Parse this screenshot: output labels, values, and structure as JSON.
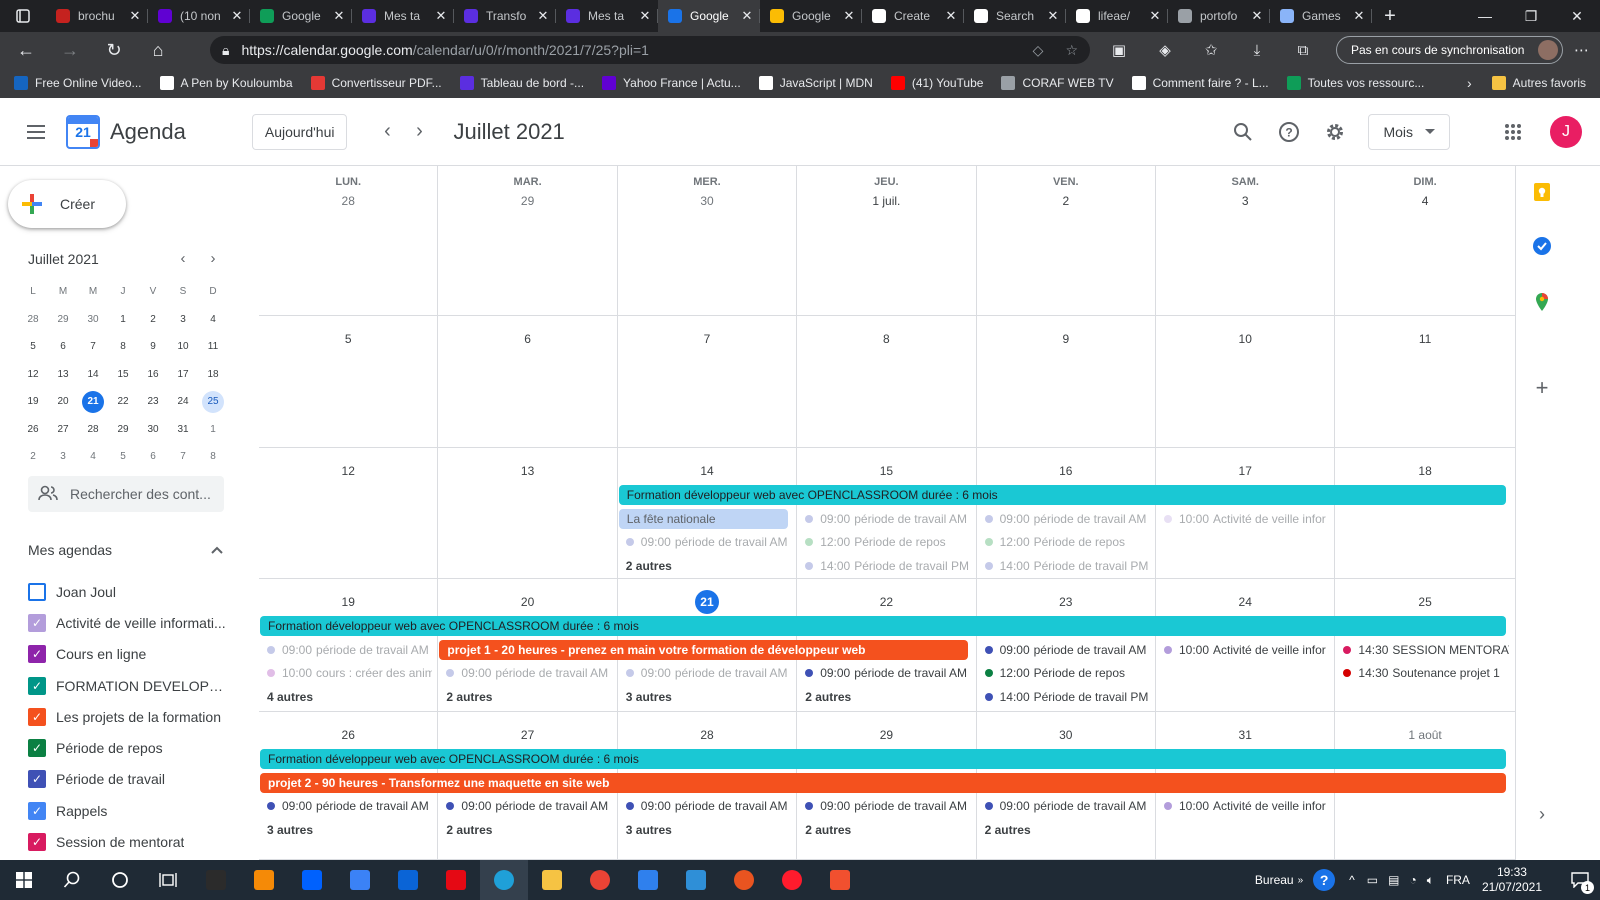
{
  "browser": {
    "tabs": [
      {
        "title": "brochu",
        "color": "#c5221f"
      },
      {
        "title": "(10 non",
        "color": "#6001d2"
      },
      {
        "title": "Google",
        "color": "#0f9d58"
      },
      {
        "title": "Mes ta",
        "color": "#5b2ee0"
      },
      {
        "title": "Transfo",
        "color": "#5b2ee0"
      },
      {
        "title": "Mes ta",
        "color": "#5b2ee0"
      },
      {
        "title": "Google",
        "color": "#1a73e8",
        "active": true
      },
      {
        "title": "Google",
        "color": "#fbbc04"
      },
      {
        "title": "Create",
        "color": "#ffffff"
      },
      {
        "title": "Search",
        "color": "#ffffff"
      },
      {
        "title": "lifeae/",
        "color": "#ffffff"
      },
      {
        "title": "portofo",
        "color": "#9aa0a6"
      },
      {
        "title": "Games",
        "color": "#8ab4f8"
      }
    ],
    "url": {
      "host": "https://calendar.google.com",
      "path": "/calendar/u/0/r/month/2021/7/25?pli=1"
    },
    "sync_label": "Pas en cours de synchronisation",
    "bookmarks": [
      {
        "label": "Free Online Video...",
        "color": "#1565c0"
      },
      {
        "label": "A Pen by Kouloumba",
        "color": "#ffffff"
      },
      {
        "label": "Convertisseur PDF...",
        "color": "#e53935"
      },
      {
        "label": "Tableau de bord -...",
        "color": "#5b2ee0"
      },
      {
        "label": "Yahoo France | Actu...",
        "color": "#6001d2"
      },
      {
        "label": "JavaScript | MDN",
        "color": "#ffffff"
      },
      {
        "label": "(41) YouTube",
        "color": "#ff0000"
      },
      {
        "label": "CORAF WEB TV",
        "color": "#9aa0a6"
      },
      {
        "label": "Comment faire ? - L...",
        "color": "#ffffff"
      },
      {
        "label": "Toutes vos ressourc...",
        "color": "#0f9d58"
      }
    ],
    "other_bookmarks": "Autres favoris"
  },
  "header": {
    "app_title": "Agenda",
    "logo_number": "21",
    "today_button": "Aujourd'hui",
    "month_title": "Juillet 2021",
    "view_selector": "Mois",
    "avatar_letter": "J"
  },
  "sidebar": {
    "create_label": "Créer",
    "mini_title": "Juillet 2021",
    "weekdays": [
      "L",
      "M",
      "M",
      "J",
      "V",
      "S",
      "D"
    ],
    "mini_days": [
      "28",
      "29",
      "30",
      "1",
      "2",
      "3",
      "4",
      "5",
      "6",
      "7",
      "8",
      "9",
      "10",
      "11",
      "12",
      "13",
      "14",
      "15",
      "16",
      "17",
      "18",
      "19",
      "20",
      "21",
      "22",
      "23",
      "24",
      "25",
      "26",
      "27",
      "28",
      "29",
      "30",
      "31",
      "1",
      "2",
      "3",
      "4",
      "5",
      "6",
      "7",
      "8"
    ],
    "search_placeholder": "Rechercher des cont...",
    "my_calendars_title": "Mes agendas",
    "calendars": [
      {
        "label": "Joan Joul",
        "color": "#1a73e8",
        "checked": false
      },
      {
        "label": "Activité de veille informati...",
        "color": "#b39ddb",
        "checked": true
      },
      {
        "label": "Cours en ligne",
        "color": "#8e24aa",
        "checked": true
      },
      {
        "label": "FORMATION DEVELOPPE...",
        "color": "#009688",
        "checked": true
      },
      {
        "label": "Les projets de la formation",
        "color": "#f4511e",
        "checked": true
      },
      {
        "label": "Période de repos",
        "color": "#0b8043",
        "checked": true
      },
      {
        "label": "Période de travail",
        "color": "#3f51b5",
        "checked": true
      },
      {
        "label": "Rappels",
        "color": "#4285f4",
        "checked": true
      },
      {
        "label": "Session de mentorat",
        "color": "#d81b60",
        "checked": true
      }
    ]
  },
  "month": {
    "weekday_headers": [
      "LUN.",
      "MAR.",
      "MER.",
      "JEU.",
      "VEN.",
      "SAM.",
      "DIM."
    ],
    "weeks": [
      [
        "28",
        "29",
        "30",
        "1 juil.",
        "2",
        "3",
        "4"
      ],
      [
        "5",
        "6",
        "7",
        "8",
        "9",
        "10",
        "11"
      ],
      [
        "12",
        "13",
        "14",
        "15",
        "16",
        "17",
        "18"
      ],
      [
        "19",
        "20",
        "21",
        "22",
        "23",
        "24",
        "25"
      ],
      [
        "26",
        "27",
        "28",
        "29",
        "30",
        "31",
        "1 août"
      ]
    ],
    "today_label": "21",
    "spans": [
      {
        "week": 2,
        "start": 2,
        "end": 6,
        "row": 0,
        "label": "Formation développeur web avec OPENCLASSROOM durée : 6 mois",
        "color": "#1ac8d4",
        "style": "dark"
      },
      {
        "week": 2,
        "start": 2,
        "end": 2,
        "row": 1,
        "label": "La fête nationale",
        "color": "#bfd5f5",
        "style": "pale"
      },
      {
        "week": 3,
        "start": 0,
        "end": 6,
        "row": 0,
        "label": "Formation développeur web avec OPENCLASSROOM durée : 6 mois",
        "color": "#1ac8d4",
        "style": "dark"
      },
      {
        "week": 3,
        "start": 1,
        "end": 3,
        "row": 1,
        "label": "projet 1 - 20 heures - prenez en main votre formation de développeur web",
        "color": "#f4511e",
        "style": "white"
      },
      {
        "week": 4,
        "start": 0,
        "end": 6,
        "row": 0,
        "label": "Formation développeur web avec OPENCLASSROOM durée : 6 mois",
        "color": "#1ac8d4",
        "style": "dark"
      },
      {
        "week": 4,
        "start": 0,
        "end": 6,
        "row": 1,
        "label": "projet 2 - 90 heures - Transformez une maquette en site web",
        "color": "#f4511e",
        "style": "white"
      }
    ],
    "events": [
      {
        "week": 2,
        "day": 2,
        "row": 2,
        "time": "09:00",
        "title": "période de travail AM",
        "color": "#c5cae9",
        "faded": true
      },
      {
        "week": 2,
        "day": 3,
        "row": 1,
        "time": "09:00",
        "title": "période de travail AM",
        "color": "#c5cae9",
        "faded": true
      },
      {
        "week": 2,
        "day": 3,
        "row": 2,
        "time": "12:00",
        "title": "Période de repos",
        "color": "#b7dfc3",
        "faded": true
      },
      {
        "week": 2,
        "day": 3,
        "row": 3,
        "time": "14:00",
        "title": "Période de travail PM",
        "color": "#c5cae9",
        "faded": true
      },
      {
        "week": 2,
        "day": 4,
        "row": 1,
        "time": "09:00",
        "title": "période de travail AM",
        "color": "#c5cae9",
        "faded": true
      },
      {
        "week": 2,
        "day": 4,
        "row": 2,
        "time": "12:00",
        "title": "Période de repos",
        "color": "#b7dfc3",
        "faded": true
      },
      {
        "week": 2,
        "day": 4,
        "row": 3,
        "time": "14:00",
        "title": "Période de travail PM",
        "color": "#c5cae9",
        "faded": true
      },
      {
        "week": 2,
        "day": 5,
        "row": 1,
        "time": "10:00",
        "title": "Activité de veille infor",
        "color": "#e8e0f4",
        "faded": true
      },
      {
        "week": 3,
        "day": 0,
        "row": 1,
        "time": "09:00",
        "title": "période de travail AM",
        "color": "#c5cae9",
        "faded": true
      },
      {
        "week": 3,
        "day": 0,
        "row": 2,
        "time": "10:00",
        "title": "cours : créer des anim",
        "color": "#e1bee7",
        "faded": true
      },
      {
        "week": 3,
        "day": 1,
        "row": 2,
        "time": "09:00",
        "title": "période de travail AM",
        "color": "#c5cae9",
        "faded": true
      },
      {
        "week": 3,
        "day": 2,
        "row": 2,
        "time": "09:00",
        "title": "période de travail AM",
        "color": "#c5cae9",
        "faded": true
      },
      {
        "week": 3,
        "day": 3,
        "row": 2,
        "time": "09:00",
        "title": "période de travail AM",
        "color": "#3f51b5",
        "faded": false
      },
      {
        "week": 3,
        "day": 4,
        "row": 1,
        "time": "09:00",
        "title": "période de travail AM",
        "color": "#3f51b5",
        "faded": false
      },
      {
        "week": 3,
        "day": 4,
        "row": 2,
        "time": "12:00",
        "title": "Période de repos",
        "color": "#0b8043",
        "faded": false
      },
      {
        "week": 3,
        "day": 4,
        "row": 3,
        "time": "14:00",
        "title": "Période de travail PM",
        "color": "#3f51b5",
        "faded": false
      },
      {
        "week": 3,
        "day": 5,
        "row": 1,
        "time": "10:00",
        "title": "Activité de veille infor",
        "color": "#b39ddb",
        "faded": false
      },
      {
        "week": 3,
        "day": 6,
        "row": 1,
        "time": "14:30",
        "title": "SESSION MENTORAT",
        "color": "#d81b60",
        "faded": false
      },
      {
        "week": 3,
        "day": 6,
        "row": 2,
        "time": "14:30",
        "title": "Soutenance projet 1",
        "color": "#d50000",
        "faded": false
      },
      {
        "week": 4,
        "day": 0,
        "row": 2,
        "time": "09:00",
        "title": "période de travail AM",
        "color": "#3f51b5",
        "faded": false
      },
      {
        "week": 4,
        "day": 1,
        "row": 2,
        "time": "09:00",
        "title": "période de travail AM",
        "color": "#3f51b5",
        "faded": false
      },
      {
        "week": 4,
        "day": 2,
        "row": 2,
        "time": "09:00",
        "title": "période de travail AM",
        "color": "#3f51b5",
        "faded": false
      },
      {
        "week": 4,
        "day": 3,
        "row": 2,
        "time": "09:00",
        "title": "période de travail AM",
        "color": "#3f51b5",
        "faded": false
      },
      {
        "week": 4,
        "day": 4,
        "row": 2,
        "time": "09:00",
        "title": "période de travail AM",
        "color": "#3f51b5",
        "faded": false
      },
      {
        "week": 4,
        "day": 5,
        "row": 2,
        "time": "10:00",
        "title": "Activité de veille infor",
        "color": "#b39ddb",
        "faded": false
      }
    ],
    "more": [
      {
        "week": 2,
        "day": 2,
        "row": 3,
        "label": "2 autres"
      },
      {
        "week": 3,
        "day": 0,
        "row": 3,
        "label": "4 autres"
      },
      {
        "week": 3,
        "day": 1,
        "row": 3,
        "label": "2 autres"
      },
      {
        "week": 3,
        "day": 2,
        "row": 3,
        "label": "3 autres"
      },
      {
        "week": 3,
        "day": 3,
        "row": 3,
        "label": "2 autres"
      },
      {
        "week": 4,
        "day": 0,
        "row": 3,
        "label": "3 autres"
      },
      {
        "week": 4,
        "day": 1,
        "row": 3,
        "label": "2 autres"
      },
      {
        "week": 4,
        "day": 2,
        "row": 3,
        "label": "3 autres"
      },
      {
        "week": 4,
        "day": 3,
        "row": 3,
        "label": "2 autres"
      },
      {
        "week": 4,
        "day": 4,
        "row": 3,
        "label": "2 autres"
      }
    ]
  },
  "taskbar": {
    "apps": [
      {
        "name": "terminal",
        "color": "#2b2b2b"
      },
      {
        "name": "sublime-text",
        "color": "#f58a07"
      },
      {
        "name": "dropbox",
        "color": "#0061fe"
      },
      {
        "name": "store",
        "color": "#3b82f6"
      },
      {
        "name": "mail",
        "color": "#0a64d6"
      },
      {
        "name": "netflix",
        "color": "#e50914"
      },
      {
        "name": "edge",
        "color": "#1fa0d8"
      },
      {
        "name": "explorer",
        "color": "#f6c343"
      },
      {
        "name": "chrome",
        "color": "#ea4335"
      },
      {
        "name": "media",
        "color": "#2f80ed"
      },
      {
        "name": "vscode",
        "color": "#2f8fd7"
      },
      {
        "name": "ubuntu",
        "color": "#e95420"
      },
      {
        "name": "opera",
        "color": "#ff1b2d"
      },
      {
        "name": "git",
        "color": "#f1502f"
      }
    ],
    "desktop_label": "Bureau",
    "language": "FRA",
    "time": "19:33",
    "date": "21/07/2021",
    "notif_count": "1"
  }
}
